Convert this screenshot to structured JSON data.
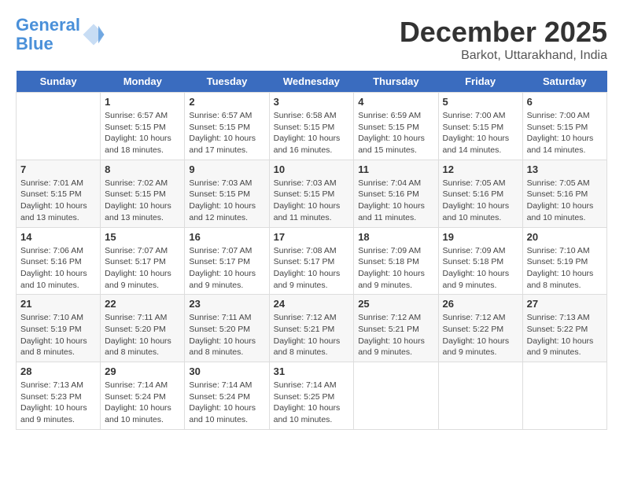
{
  "header": {
    "logo_line1": "General",
    "logo_line2": "Blue",
    "month": "December 2025",
    "location": "Barkot, Uttarakhand, India"
  },
  "days_of_week": [
    "Sunday",
    "Monday",
    "Tuesday",
    "Wednesday",
    "Thursday",
    "Friday",
    "Saturday"
  ],
  "weeks": [
    [
      {
        "day": "",
        "info": ""
      },
      {
        "day": "1",
        "info": "Sunrise: 6:57 AM\nSunset: 5:15 PM\nDaylight: 10 hours and 18 minutes."
      },
      {
        "day": "2",
        "info": "Sunrise: 6:57 AM\nSunset: 5:15 PM\nDaylight: 10 hours and 17 minutes."
      },
      {
        "day": "3",
        "info": "Sunrise: 6:58 AM\nSunset: 5:15 PM\nDaylight: 10 hours and 16 minutes."
      },
      {
        "day": "4",
        "info": "Sunrise: 6:59 AM\nSunset: 5:15 PM\nDaylight: 10 hours and 15 minutes."
      },
      {
        "day": "5",
        "info": "Sunrise: 7:00 AM\nSunset: 5:15 PM\nDaylight: 10 hours and 14 minutes."
      },
      {
        "day": "6",
        "info": "Sunrise: 7:00 AM\nSunset: 5:15 PM\nDaylight: 10 hours and 14 minutes."
      }
    ],
    [
      {
        "day": "7",
        "info": "Sunrise: 7:01 AM\nSunset: 5:15 PM\nDaylight: 10 hours and 13 minutes."
      },
      {
        "day": "8",
        "info": "Sunrise: 7:02 AM\nSunset: 5:15 PM\nDaylight: 10 hours and 13 minutes."
      },
      {
        "day": "9",
        "info": "Sunrise: 7:03 AM\nSunset: 5:15 PM\nDaylight: 10 hours and 12 minutes."
      },
      {
        "day": "10",
        "info": "Sunrise: 7:03 AM\nSunset: 5:15 PM\nDaylight: 10 hours and 11 minutes."
      },
      {
        "day": "11",
        "info": "Sunrise: 7:04 AM\nSunset: 5:16 PM\nDaylight: 10 hours and 11 minutes."
      },
      {
        "day": "12",
        "info": "Sunrise: 7:05 AM\nSunset: 5:16 PM\nDaylight: 10 hours and 10 minutes."
      },
      {
        "day": "13",
        "info": "Sunrise: 7:05 AM\nSunset: 5:16 PM\nDaylight: 10 hours and 10 minutes."
      }
    ],
    [
      {
        "day": "14",
        "info": "Sunrise: 7:06 AM\nSunset: 5:16 PM\nDaylight: 10 hours and 10 minutes."
      },
      {
        "day": "15",
        "info": "Sunrise: 7:07 AM\nSunset: 5:17 PM\nDaylight: 10 hours and 9 minutes."
      },
      {
        "day": "16",
        "info": "Sunrise: 7:07 AM\nSunset: 5:17 PM\nDaylight: 10 hours and 9 minutes."
      },
      {
        "day": "17",
        "info": "Sunrise: 7:08 AM\nSunset: 5:17 PM\nDaylight: 10 hours and 9 minutes."
      },
      {
        "day": "18",
        "info": "Sunrise: 7:09 AM\nSunset: 5:18 PM\nDaylight: 10 hours and 9 minutes."
      },
      {
        "day": "19",
        "info": "Sunrise: 7:09 AM\nSunset: 5:18 PM\nDaylight: 10 hours and 9 minutes."
      },
      {
        "day": "20",
        "info": "Sunrise: 7:10 AM\nSunset: 5:19 PM\nDaylight: 10 hours and 8 minutes."
      }
    ],
    [
      {
        "day": "21",
        "info": "Sunrise: 7:10 AM\nSunset: 5:19 PM\nDaylight: 10 hours and 8 minutes."
      },
      {
        "day": "22",
        "info": "Sunrise: 7:11 AM\nSunset: 5:20 PM\nDaylight: 10 hours and 8 minutes."
      },
      {
        "day": "23",
        "info": "Sunrise: 7:11 AM\nSunset: 5:20 PM\nDaylight: 10 hours and 8 minutes."
      },
      {
        "day": "24",
        "info": "Sunrise: 7:12 AM\nSunset: 5:21 PM\nDaylight: 10 hours and 8 minutes."
      },
      {
        "day": "25",
        "info": "Sunrise: 7:12 AM\nSunset: 5:21 PM\nDaylight: 10 hours and 9 minutes."
      },
      {
        "day": "26",
        "info": "Sunrise: 7:12 AM\nSunset: 5:22 PM\nDaylight: 10 hours and 9 minutes."
      },
      {
        "day": "27",
        "info": "Sunrise: 7:13 AM\nSunset: 5:22 PM\nDaylight: 10 hours and 9 minutes."
      }
    ],
    [
      {
        "day": "28",
        "info": "Sunrise: 7:13 AM\nSunset: 5:23 PM\nDaylight: 10 hours and 9 minutes."
      },
      {
        "day": "29",
        "info": "Sunrise: 7:14 AM\nSunset: 5:24 PM\nDaylight: 10 hours and 10 minutes."
      },
      {
        "day": "30",
        "info": "Sunrise: 7:14 AM\nSunset: 5:24 PM\nDaylight: 10 hours and 10 minutes."
      },
      {
        "day": "31",
        "info": "Sunrise: 7:14 AM\nSunset: 5:25 PM\nDaylight: 10 hours and 10 minutes."
      },
      {
        "day": "",
        "info": ""
      },
      {
        "day": "",
        "info": ""
      },
      {
        "day": "",
        "info": ""
      }
    ]
  ]
}
